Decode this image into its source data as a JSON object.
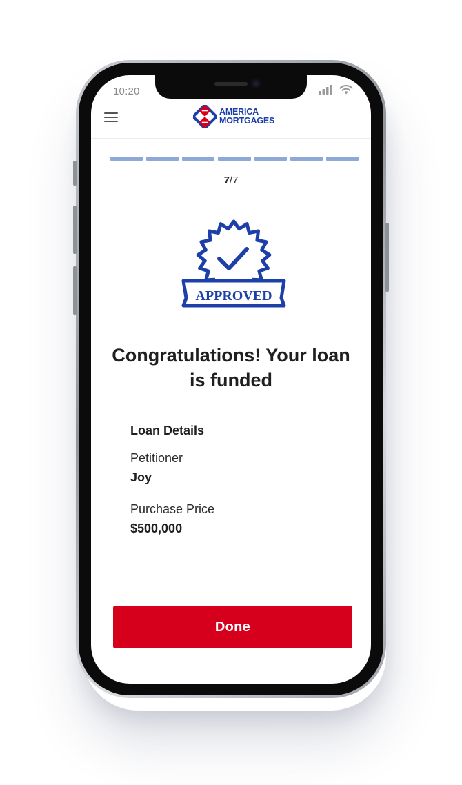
{
  "status_bar": {
    "time": "10:20",
    "signal_icon": "cellular-signal-icon",
    "wifi_icon": "wifi-icon"
  },
  "header": {
    "menu_icon": "hamburger-menu-icon",
    "logo_line1": "AMERICA",
    "logo_line2": "MORTGAGES"
  },
  "progress": {
    "total_steps": 7,
    "completed_steps": 7,
    "current": "7",
    "separator_total": "/7"
  },
  "badge": {
    "icon": "approved-seal-icon",
    "text": "APPROVED"
  },
  "headline": "Congratulations! Your loan is funded",
  "loan_details": {
    "title": "Loan Details",
    "petitioner_label": "Petitioner",
    "petitioner_value": "Joy",
    "price_label": "Purchase Price",
    "price_value": "$500,000"
  },
  "done_button": {
    "label": "Done"
  },
  "colors": {
    "brand_blue": "#1d3fa8",
    "brand_red": "#d6001c",
    "progress": "#8ea9d8"
  }
}
